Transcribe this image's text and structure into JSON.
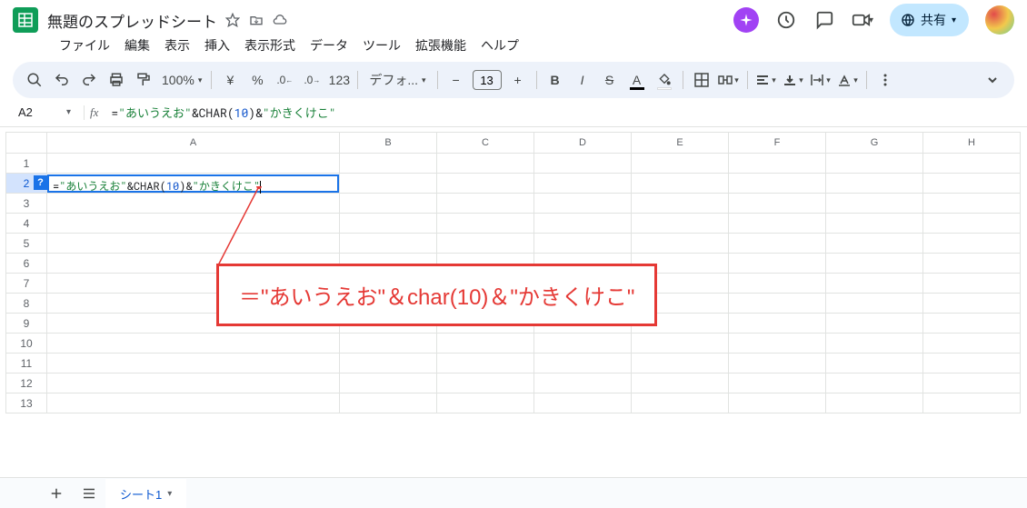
{
  "header": {
    "title": "無題のスプレッドシート",
    "share_label": "共有"
  },
  "menu": [
    "ファイル",
    "編集",
    "表示",
    "挿入",
    "表示形式",
    "データ",
    "ツール",
    "拡張機能",
    "ヘルプ"
  ],
  "toolbar": {
    "zoom": "100%",
    "font_name": "デフォ...",
    "font_size": "13"
  },
  "namebox": "A2",
  "formula_parts": {
    "eq": "=",
    "s1": "\"あいうえお\"",
    "amp1": "&",
    "fn": "CHAR",
    "lp": "(",
    "num": "10",
    "rp": ")",
    "amp2": "&",
    "s2": "\"かきくけこ\""
  },
  "columns": [
    "A",
    "B",
    "C",
    "D",
    "E",
    "F",
    "G",
    "H"
  ],
  "rows": [
    "1",
    "2",
    "3",
    "4",
    "5",
    "6",
    "7",
    "8",
    "9",
    "10",
    "11",
    "12",
    "13"
  ],
  "active_cell": {
    "ref": "A2",
    "help": "?"
  },
  "annotation": "＝\"あいうえお\"＆char(10)＆\"かきくけこ\"",
  "sheet_tab": "シート1"
}
